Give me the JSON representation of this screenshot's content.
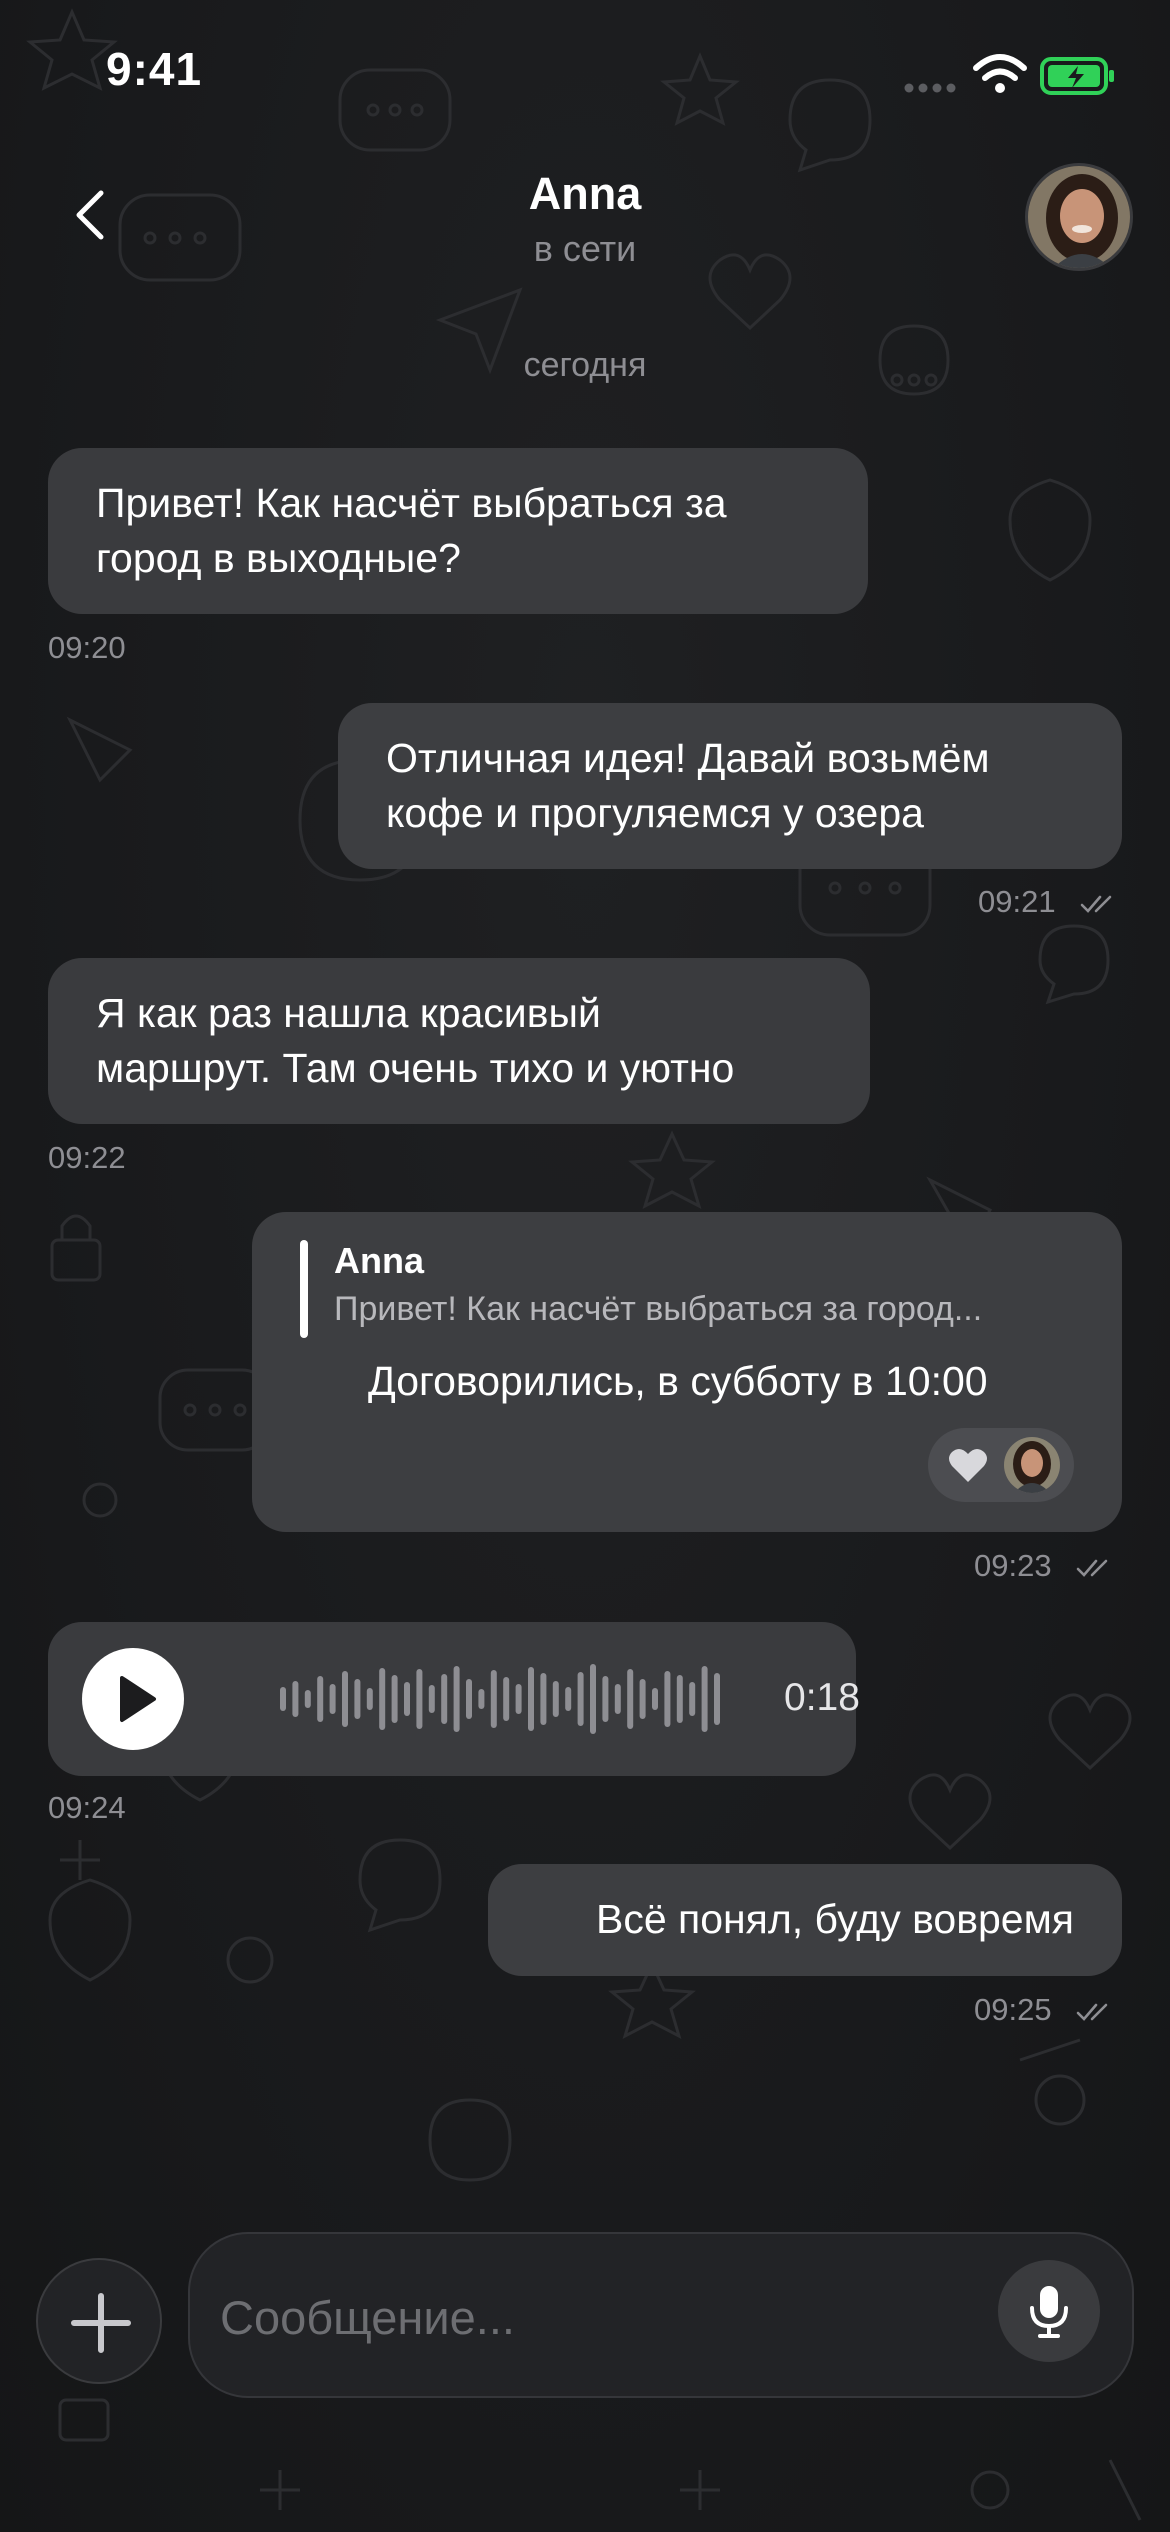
{
  "status_bar": {
    "time": "9:41",
    "battery_color": "#30d158"
  },
  "header": {
    "name": "Anna",
    "status": "в сети"
  },
  "date_separator": "сегодня",
  "messages": [
    {
      "direction": "in",
      "lines": [
        "Привет! Как насчёт выбраться за",
        "город в выходные?"
      ],
      "time": "09:20"
    },
    {
      "direction": "out",
      "lines": [
        "Отличная идея! Давай возьмём",
        "кофе и прогуляемся у озера"
      ],
      "time": "09:21",
      "read": true
    },
    {
      "direction": "in",
      "lines": [
        "Я как раз нашла красивый",
        "маршрут. Там очень тихо и уютно"
      ],
      "time": "09:22"
    },
    {
      "direction": "out",
      "reply_to": {
        "name": "Anna",
        "text": "Привет! Как насчёт выбраться за город..."
      },
      "lines": [
        "Договорились, в субботу в 10:00"
      ],
      "reaction": "heart-icon",
      "time": "09:23",
      "read": true
    },
    {
      "direction": "in",
      "type": "voice",
      "duration": "0:18",
      "time": "09:24"
    },
    {
      "direction": "out",
      "lines": [
        "Всё понял, буду вовремя"
      ],
      "time": "09:25",
      "read": true
    }
  ],
  "composer": {
    "placeholder": "Сообщение...",
    "value": ""
  },
  "icons": [
    "back-chevron-icon",
    "plus-icon",
    "microphone-icon",
    "play-icon",
    "double-check-icon",
    "heart-icon",
    "wifi-icon",
    "battery-charging-icon",
    "signal-icon"
  ]
}
